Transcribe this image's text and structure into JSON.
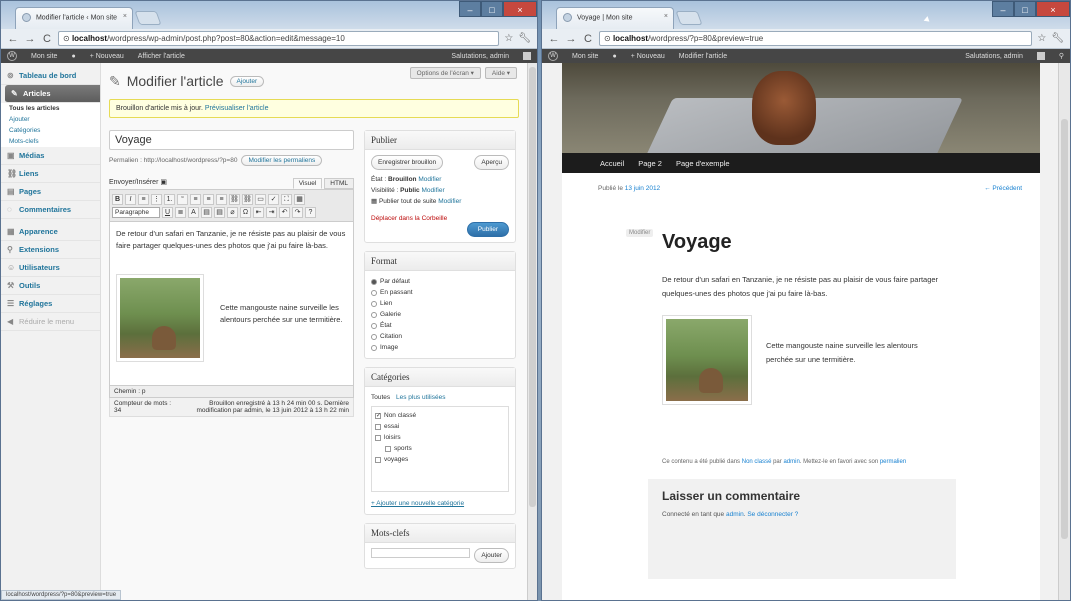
{
  "left": {
    "tab_title": "Modifier l'article ‹ Mon site",
    "url_host": "localhost",
    "url_path": "/wordpress/wp-admin/post.php?post=80&action=edit&message=10",
    "adminbar": {
      "site": "Mon site",
      "new": "+ Nouveau",
      "view": "Afficher l'article",
      "greeting": "Salutations, admin"
    },
    "menu": {
      "dashboard": "Tableau de bord",
      "articles": "Articles",
      "sub": [
        "Tous les articles",
        "Ajouter",
        "Catégories",
        "Mots-clefs"
      ],
      "items": [
        "Médias",
        "Liens",
        "Pages",
        "Commentaires",
        "Apparence",
        "Extensions",
        "Utilisateurs",
        "Outils",
        "Réglages",
        "Réduire le menu"
      ]
    },
    "page_title": "Modifier l'article",
    "add_button": "Ajouter",
    "screen_options": "Options de l'écran ▾",
    "help": "Aide ▾",
    "notice_text": "Brouillon d'article mis à jour.",
    "notice_link": "Prévisualiser l'article",
    "post_title": "Voyage",
    "permalink_label": "Permalien : http://localhost/wordpress/?p=80",
    "permalink_button": "Modifier les permaliens",
    "upload_insert": "Envoyer/Insérer",
    "tab_visual": "Visuel",
    "tab_html": "HTML",
    "format_select": "Paragraphe",
    "body_text": "De retour d'un safari en Tanzanie, je ne résiste pas au plaisir de vous faire partager quelques-unes des photos que j'ai pu faire là-bas.",
    "caption": "Cette mangouste naine surveille les alentours perchée sur une termitière.",
    "path": "Chemin : p",
    "word_count": "Compteur de mots : 34",
    "saved_info": "Brouillon enregistré à 13 h 24 min 00 s. Dernière modification par admin, le 13 juin 2012 à 13 h 22 min",
    "publish": {
      "title": "Publier",
      "save_draft": "Enregistrer brouillon",
      "preview": "Aperçu",
      "state_label": "État :",
      "state_value": "Brouillon",
      "visibility_label": "Visibilité :",
      "visibility_value": "Public",
      "schedule_label": "Publier tout de suite",
      "modify": "Modifier",
      "trash": "Déplacer dans la Corbeille",
      "publish_button": "Publier"
    },
    "format": {
      "title": "Format",
      "options": [
        "Par défaut",
        "En passant",
        "Lien",
        "Galerie",
        "État",
        "Citation",
        "Image"
      ]
    },
    "categories": {
      "title": "Catégories",
      "tab_all": "Toutes",
      "tab_popular": "Les plus utilisées",
      "items": [
        "Non classé",
        "essai",
        "loisirs",
        "sports",
        "voyages"
      ],
      "add": "+ Ajouter une nouvelle catégorie"
    },
    "tags": {
      "title": "Mots-clefs",
      "add": "Ajouter"
    },
    "status_url": "localhost/wordpress/?p=80&preview=true"
  },
  "right": {
    "tab_title": "Voyage | Mon site",
    "url_host": "localhost",
    "url_path": "/wordpress/?p=80&preview=true",
    "adminbar": {
      "site": "Mon site",
      "new": "+ Nouveau",
      "edit": "Modifier l'article",
      "greeting": "Salutations, admin"
    },
    "menu": [
      "Accueil",
      "Page 2",
      "Page d'exemple"
    ],
    "published_on": "Publié le",
    "date": "13 juin 2012",
    "previous": "← Précédent",
    "modify": "Modifier",
    "title": "Voyage",
    "body_text": "De retour d'un safari en Tanzanie, je ne résiste pas au plaisir de vous faire partager quelques-unes des photos que j'ai pu faire là-bas.",
    "caption": "Cette mangouste naine surveille les alentours perchée sur une termitière.",
    "meta_prefix": "Ce contenu a été publié dans",
    "meta_cat": "Non classé",
    "meta_mid": "par",
    "meta_author": "admin",
    "meta_suffix": ". Mettez-le en favori avec son",
    "meta_perma": "permalien",
    "comment_title": "Laisser un commentaire",
    "connected": "Connecté en tant que",
    "connected_user": "admin",
    "logout": "Se déconnecter ?"
  }
}
